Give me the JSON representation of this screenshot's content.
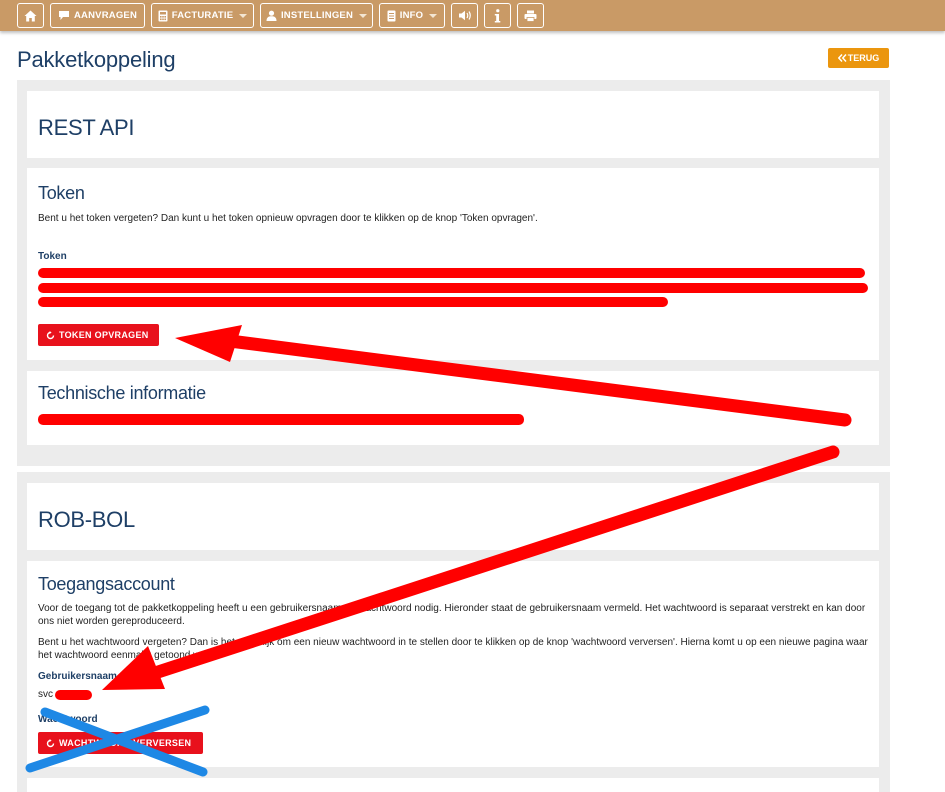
{
  "navbar": {
    "items": [
      {
        "id": "home",
        "label": ""
      },
      {
        "id": "aanvragen",
        "label": "AANVRAGEN"
      },
      {
        "id": "facturatie",
        "label": "FACTURATIE"
      },
      {
        "id": "instellingen",
        "label": "INSTELLINGEN"
      },
      {
        "id": "info",
        "label": "INFO"
      }
    ]
  },
  "page": {
    "title": "Pakketkoppeling",
    "back_label": "TERUG"
  },
  "rest_api": {
    "heading": "REST API",
    "token": {
      "heading": "Token",
      "description": "Bent u het token vergeten? Dan kunt u het token opnieuw opvragen door te klikken op de knop 'Token opvragen'.",
      "label": "Token",
      "button_label": "TOKEN OPVRAGEN"
    },
    "technische": {
      "heading": "Technische informatie"
    }
  },
  "rob_bol": {
    "heading": "ROB-BOL",
    "toegangsaccount": {
      "heading": "Toegangsaccount",
      "para1": "Voor de toegang tot de pakketkoppeling heeft u een gebruikersnaam en wachtwoord nodig. Hieronder staat de gebruikersnaam vermeld. Het wachtwoord is separaat verstrekt en kan door ons niet worden gereproduceerd.",
      "para2": "Bent u het wachtwoord vergeten? Dan is het mogelijk om een nieuw wachtwoord in te stellen door te klikken op de knop 'wachtwoord verversen'. Hierna komt u op een nieuwe pagina waar het wachtwoord eenmalig getoond wordt.",
      "username_label": "Gebruikersnaam",
      "username_value": "svc",
      "password_label": "Wachtwoord",
      "button_label": "WACHTWOORD VERVERSEN"
    }
  },
  "colors": {
    "navbar": "#c99a66",
    "heading": "#1e3f66",
    "accent_red": "#e8111c",
    "back_orange": "#eb960e",
    "annotation_red": "#ff0000",
    "annotation_blue": "#1e88e5"
  }
}
